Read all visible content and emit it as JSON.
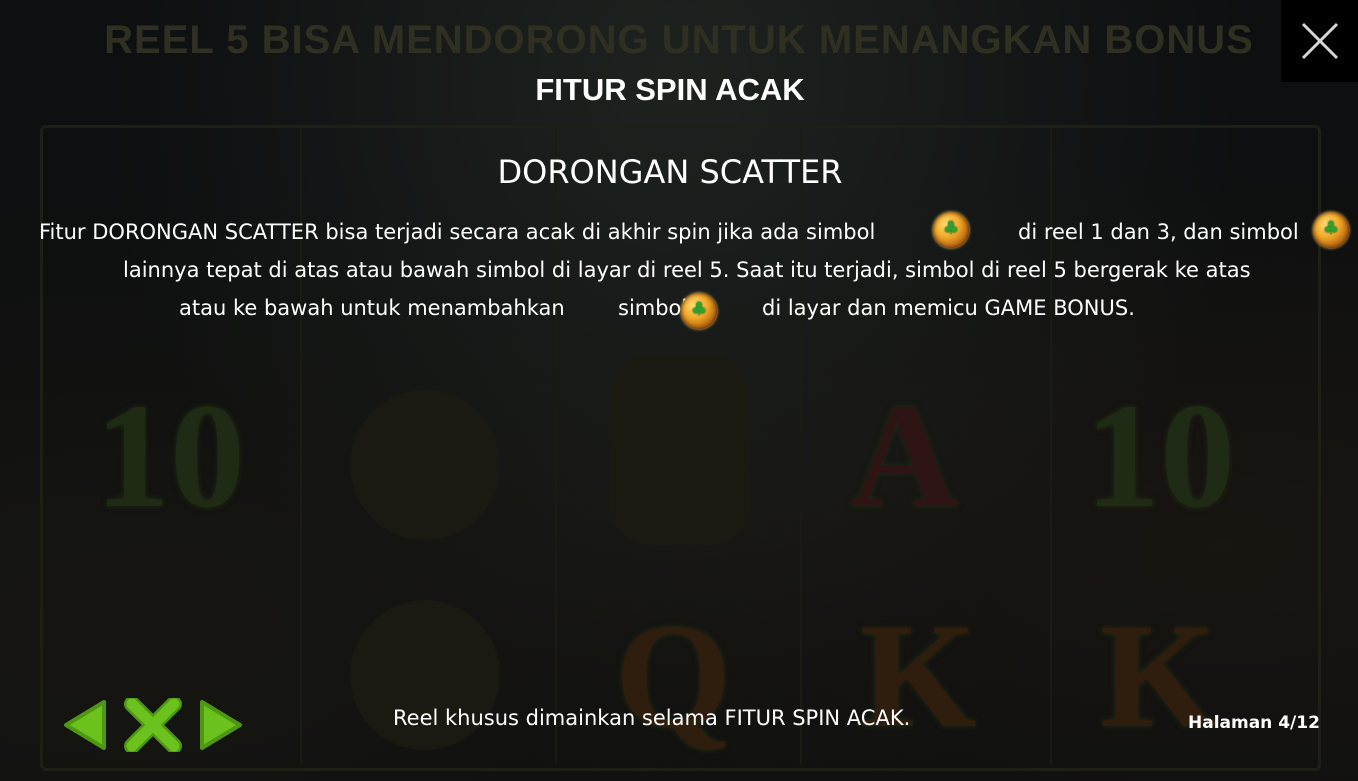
{
  "background": {
    "banner_text": "REEL 5 BISA MENDORONG UNTUK MENANGKAN BONUS"
  },
  "close_button": {
    "icon": "close-icon"
  },
  "page": {
    "title": "FITUR SPIN ACAK",
    "section_title": "DORONGAN SCATTER",
    "paragraph": {
      "l1a": "Fitur DORONGAN SCATTER bisa terjadi secara acak di akhir spin jika ada simbol",
      "l1b": "di reel 1 dan 3, dan simbol",
      "l2": "lainnya tepat di atas atau bawah simbol di layar di reel 5. Saat itu terjadi, simbol di reel 5 bergerak ke atas",
      "l3a": "atau ke bawah untuk menambahkan",
      "l3b": "simbol",
      "l3c": "di layar dan memicu GAME BONUS."
    },
    "scatter_symbol_icon": "pot-of-gold-icon",
    "footer_text": "Reel khusus dimainkan selama FITUR SPIN ACAK.",
    "page_indicator": "Halaman 4/12"
  },
  "navigation": {
    "prev_icon": "arrow-left-icon",
    "close_icon": "x-icon",
    "next_icon": "arrow-right-icon"
  },
  "colors": {
    "nav_green": "#6cc21d",
    "text": "#ffffff",
    "background": "#0d0f10"
  }
}
